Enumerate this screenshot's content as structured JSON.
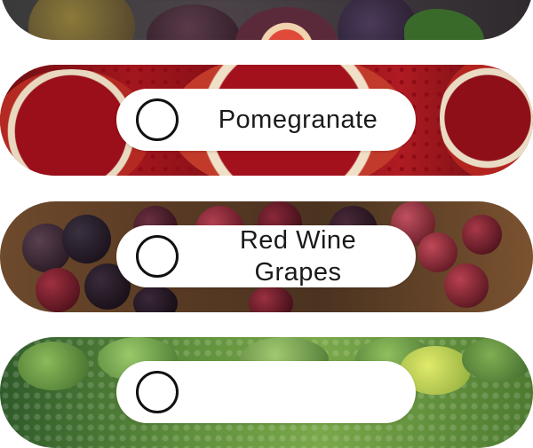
{
  "options": [
    {
      "id": "fig",
      "label": "",
      "selected": false,
      "icon": "fig-photo"
    },
    {
      "id": "pomegranate",
      "label": "Pomegranate",
      "selected": false,
      "icon": "pomegranate-photo"
    },
    {
      "id": "grapes",
      "label": "Red Wine\nGrapes",
      "selected": false,
      "icon": "grapes-photo"
    },
    {
      "id": "lime",
      "label": "",
      "selected": false,
      "icon": "lime-photo"
    }
  ],
  "colors": {
    "pill_background": "#ffffff",
    "radio_border": "#111111",
    "text": "#1a1a1a"
  }
}
